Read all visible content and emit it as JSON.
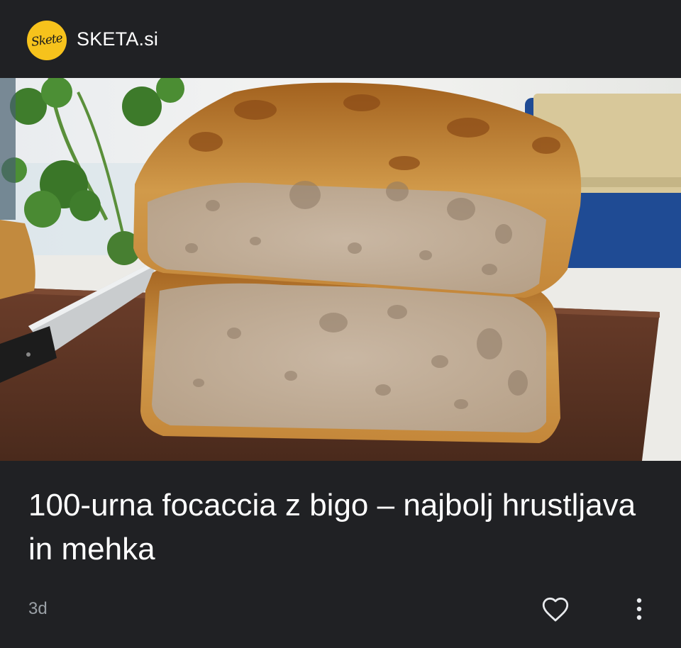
{
  "source": {
    "logo_text": "Skete",
    "name": "SKETA.si"
  },
  "article": {
    "title": "100-urna focaccia z bigo – najbolj hrustljava in mehka",
    "age": "3d",
    "image_alt": "focaccia-photo"
  },
  "actions": {
    "like_icon": "heart-outline-icon",
    "more_icon": "more-vert-icon"
  },
  "colors": {
    "background": "#202124",
    "logo_bg": "#f6c21c",
    "title_text": "#ffffff",
    "meta_text": "#9aa0a6"
  }
}
